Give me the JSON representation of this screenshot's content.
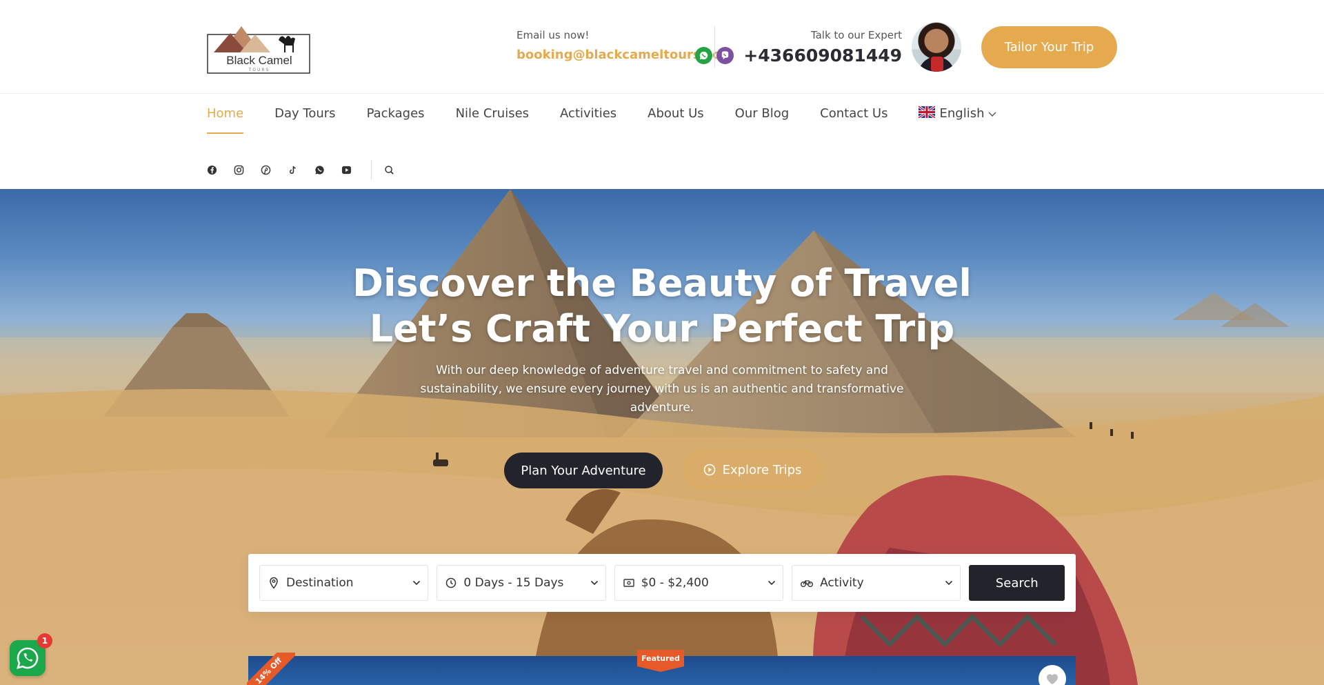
{
  "brand": {
    "logo_text": "Black Camel",
    "logo_subtext": "TOURS"
  },
  "header": {
    "email_label": "Email us now!",
    "email_value": "booking@blackcameltours.com",
    "expert_label": "Talk to our Expert",
    "phone_value": "+436609081449",
    "cta_label": "Tailor Your Trip"
  },
  "nav": {
    "items": [
      {
        "label": "Home"
      },
      {
        "label": "Day Tours"
      },
      {
        "label": "Packages"
      },
      {
        "label": "Nile Cruises"
      },
      {
        "label": "Activities"
      },
      {
        "label": "About Us"
      },
      {
        "label": "Our Blog"
      },
      {
        "label": "Contact Us"
      }
    ],
    "language": "English"
  },
  "social": [
    "facebook-icon",
    "instagram-icon",
    "pinterest-icon",
    "tiktok-icon",
    "whatsapp-icon",
    "youtube-icon"
  ],
  "hero": {
    "title_line1": "Discover the Beauty of Travel",
    "title_line2": "Let’s Craft Your Perfect Trip",
    "subtitle": "With our deep knowledge of adventure travel and commitment to safety and sustainability, we ensure every journey with us is an authentic and transformative adventure.",
    "primary_btn": "Plan Your Adventure",
    "secondary_btn": "Explore Trips"
  },
  "search": {
    "destination": "Destination",
    "duration": "0 Days - 15 Days",
    "price": "$0 - $2,400",
    "activity": "Activity",
    "button": "Search"
  },
  "card": {
    "discount": "14% Off",
    "badge": "Featured"
  },
  "whatsapp_badge": "1",
  "colors": {
    "accent": "#e5a94e",
    "dark": "#23232b",
    "badge": "#e65a2a"
  }
}
